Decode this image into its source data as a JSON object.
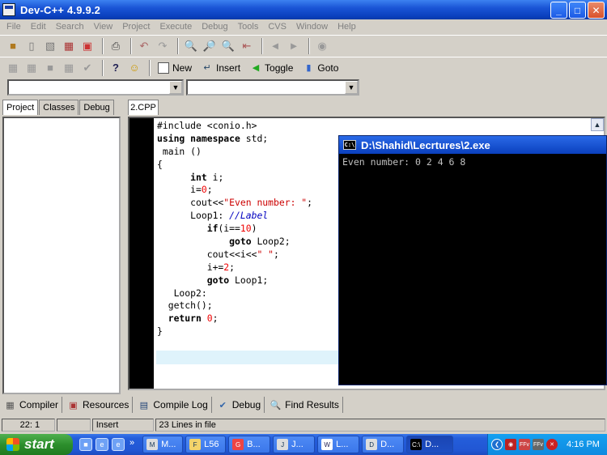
{
  "window": {
    "title": "Dev-C++ 4.9.9.2",
    "minimize": "_",
    "maximize": "□",
    "close": "✕"
  },
  "menu": [
    "File",
    "Edit",
    "Search",
    "View",
    "Project",
    "Execute",
    "Debug",
    "Tools",
    "CVS",
    "Window",
    "Help"
  ],
  "toolbar2": {
    "new_label": "New",
    "insert_label": "Insert",
    "toggle_label": "Toggle",
    "goto_label": "Goto"
  },
  "left_tabs": [
    "Project",
    "Classes",
    "Debug"
  ],
  "editor_tab": "2.CPP",
  "code_lines": [
    [
      {
        "t": "#include <conio.h>",
        "c": "pp"
      }
    ],
    [
      {
        "t": "using namespace",
        "c": "kw"
      },
      {
        "t": " std;",
        "c": ""
      }
    ],
    [
      {
        "t": " main ()",
        "c": ""
      }
    ],
    [
      {
        "t": "{",
        "c": ""
      }
    ],
    [
      {
        "t": "      ",
        "c": ""
      },
      {
        "t": "int",
        "c": "kw"
      },
      {
        "t": " i;",
        "c": ""
      }
    ],
    [
      {
        "t": "      i=",
        "c": ""
      },
      {
        "t": "0",
        "c": "num"
      },
      {
        "t": ";",
        "c": ""
      }
    ],
    [
      {
        "t": "      cout<<",
        "c": ""
      },
      {
        "t": "\"Even number: \"",
        "c": "str"
      },
      {
        "t": ";",
        "c": ""
      }
    ],
    [
      {
        "t": "      Loop1: ",
        "c": ""
      },
      {
        "t": "//Label",
        "c": "cmt"
      }
    ],
    [
      {
        "t": "         ",
        "c": ""
      },
      {
        "t": "if",
        "c": "kw"
      },
      {
        "t": "(i==",
        "c": ""
      },
      {
        "t": "10",
        "c": "num"
      },
      {
        "t": ")",
        "c": ""
      }
    ],
    [
      {
        "t": "             ",
        "c": ""
      },
      {
        "t": "goto",
        "c": "kw"
      },
      {
        "t": " Loop2;",
        "c": ""
      }
    ],
    [
      {
        "t": "         cout<<i<<",
        "c": ""
      },
      {
        "t": "\" \"",
        "c": "str"
      },
      {
        "t": ";",
        "c": ""
      }
    ],
    [
      {
        "t": "         i+=",
        "c": ""
      },
      {
        "t": "2",
        "c": "num"
      },
      {
        "t": ";",
        "c": ""
      }
    ],
    [
      {
        "t": "         ",
        "c": ""
      },
      {
        "t": "goto",
        "c": "kw"
      },
      {
        "t": " Loop1;",
        "c": ""
      }
    ],
    [
      {
        "t": "   Loop2:",
        "c": ""
      }
    ],
    [
      {
        "t": "  getch();",
        "c": ""
      }
    ],
    [
      {
        "t": "  ",
        "c": ""
      },
      {
        "t": "return",
        "c": "kw"
      },
      {
        "t": " ",
        "c": ""
      },
      {
        "t": "0",
        "c": "num"
      },
      {
        "t": ";",
        "c": ""
      }
    ],
    [
      {
        "t": "}",
        "c": ""
      }
    ]
  ],
  "console": {
    "title": "D:\\Shahid\\Lecrtures\\2.exe",
    "icon_label": "C:\\",
    "output": "Even number: 0 2 4 6 8"
  },
  "bottom_tabs": [
    {
      "label": "Compiler",
      "icon": "compiler-icon"
    },
    {
      "label": "Resources",
      "icon": "resources-icon"
    },
    {
      "label": "Compile Log",
      "icon": "compile-log-icon"
    },
    {
      "label": "Debug",
      "icon": "debug-icon"
    },
    {
      "label": "Find Results",
      "icon": "find-results-icon"
    }
  ],
  "status": {
    "position": "22: 1",
    "mode": "Insert",
    "lines": "23 Lines in file"
  },
  "taskbar": {
    "start": "start",
    "chevron": "»",
    "tasks": [
      {
        "label": "M...",
        "icon": "M"
      },
      {
        "label": "L56",
        "icon": "F"
      },
      {
        "label": "B...",
        "icon": "G"
      },
      {
        "label": "J...",
        "icon": "J"
      },
      {
        "label": "L...",
        "icon": "W"
      },
      {
        "label": "D...",
        "icon": "D"
      },
      {
        "label": "D...",
        "icon": "C:\\"
      }
    ],
    "tray_icons": [
      "FFv",
      "FFv"
    ],
    "clock": "4:16 PM"
  },
  "colors": {
    "title_bar": "#0a3fbd",
    "keyword": "#000000",
    "number": "#ee0000",
    "string": "#cc0000",
    "comment": "#0000c0",
    "current_line": "#dff3fb",
    "console_bg": "#000000",
    "console_text": "#c0c0c0"
  }
}
